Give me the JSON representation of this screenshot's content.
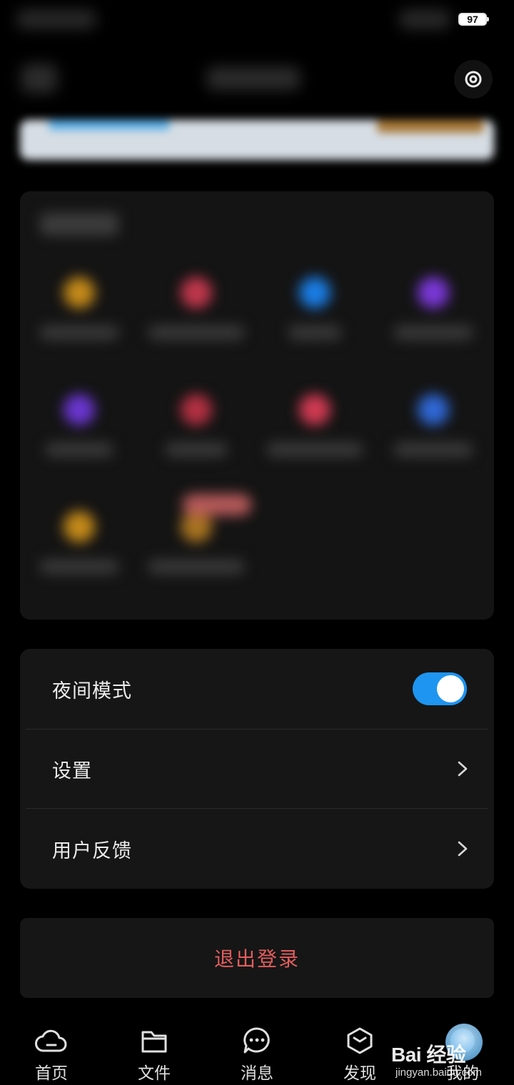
{
  "status_bar": {
    "battery_level": "97"
  },
  "settings": {
    "night_mode_label": "夜间模式",
    "night_mode_on": true,
    "settings_label": "设置",
    "feedback_label": "用户反馈"
  },
  "logout_label": "退出登录",
  "nav": {
    "items": [
      {
        "label": "首页",
        "icon": "cloud-icon"
      },
      {
        "label": "文件",
        "icon": "folder-icon"
      },
      {
        "label": "消息",
        "icon": "message-icon"
      },
      {
        "label": "发现",
        "icon": "discover-icon"
      },
      {
        "label": "我的",
        "icon": "avatar"
      }
    ]
  },
  "watermark": {
    "main": "Bai 经验",
    "sub": "jingyan.baidu.com"
  },
  "colors": {
    "toggle_on": "#1e95f0",
    "logout_red": "#e25d5d",
    "card_bg": "#161616",
    "page_bg": "#000000"
  }
}
